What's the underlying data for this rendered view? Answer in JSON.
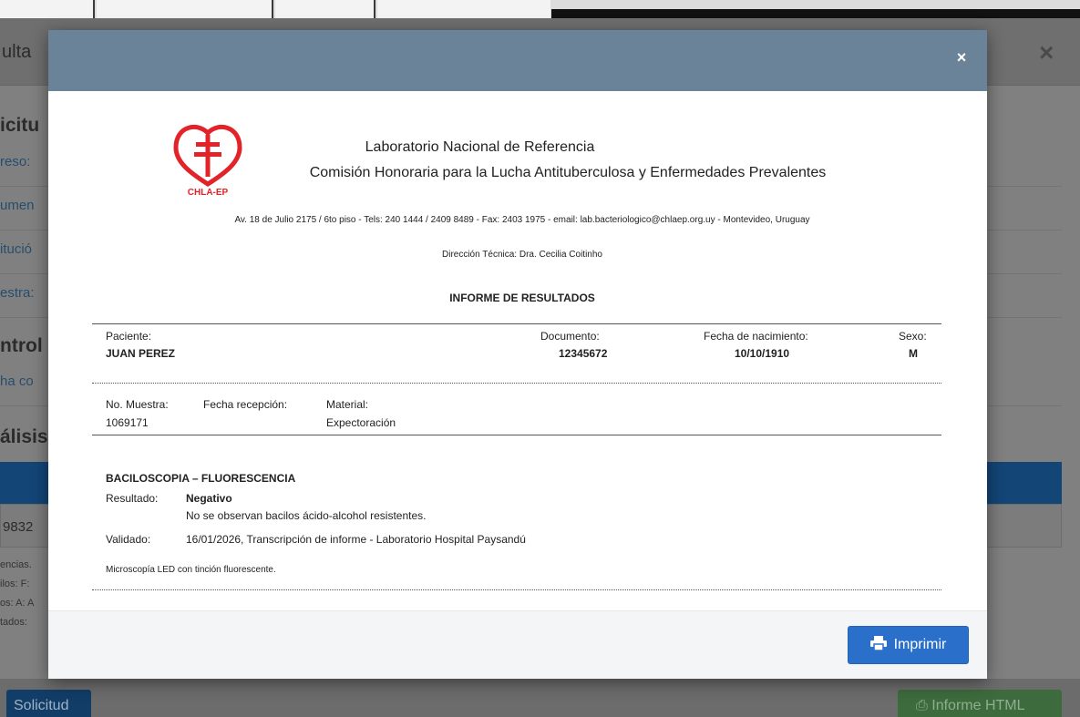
{
  "background": {
    "title": "ulta",
    "close_icon": "×",
    "heading_solicitud": "icitu",
    "row_ingreso": "reso:",
    "row_documento": "umen",
    "row_institucion": "itució",
    "row_muestra": "estra:",
    "heading_control": "ntrol",
    "row_fecha_control": "ha co",
    "heading_analisis": "álisis",
    "cell_value": "9832",
    "notes": [
      "encias.",
      "ilos: F:",
      "os: A: A",
      "tados:"
    ],
    "btn_solicitud": "Solicitud",
    "btn_informe_html": "Informe HTML"
  },
  "modal": {
    "close_label": "×",
    "logo_text": "CHLA-EP",
    "lab_name": "Laboratorio Nacional de Referencia",
    "commission": "Comisión Honoraria para la Lucha Antituberculosa y Enfermedades Prevalentes",
    "address": "Av. 18 de Julio 2175 / 6to piso - Tels: 240 1444 / 2409 8489 - Fax: 2403 1975 - email: lab.bacteriologico@chlaep.org.uy - Montevideo, Uruguay",
    "direction": "Dirección Técnica: Dra. Cecilia Coitinho",
    "report_title": "INFORME DE RESULTADOS",
    "patient": {
      "label": "Paciente:",
      "value": "JUAN PEREZ",
      "doc_label": "Documento:",
      "doc_value": "12345672",
      "dob_label": "Fecha de nacimiento:",
      "dob_value": "10/10/1910",
      "sex_label": "Sexo:",
      "sex_value": "M"
    },
    "sample": {
      "no_label": "No. Muestra:",
      "no_value": "1069171",
      "reception_label": "Fecha recepción:",
      "reception_value": "",
      "material_label": "Material:",
      "material_value": "Expectoración"
    },
    "analysis": {
      "title": "BACILOSCOPIA – FLUORESCENCIA",
      "result_label": "Resultado:",
      "result_value": "Negativo",
      "result_detail": "No se observan bacilos ácido-alcohol resistentes.",
      "validated_label": "Validado:",
      "validated_value": "16/01/2026, Transcripción de informe - Laboratorio Hospital Paysandú",
      "note": "Microscopía LED con tinción fluorescente."
    },
    "print_label": "Imprimir"
  },
  "colors": {
    "modal_header": "#6a8399",
    "print_button": "#2a6fc9",
    "logo_red": "#e3232a"
  }
}
